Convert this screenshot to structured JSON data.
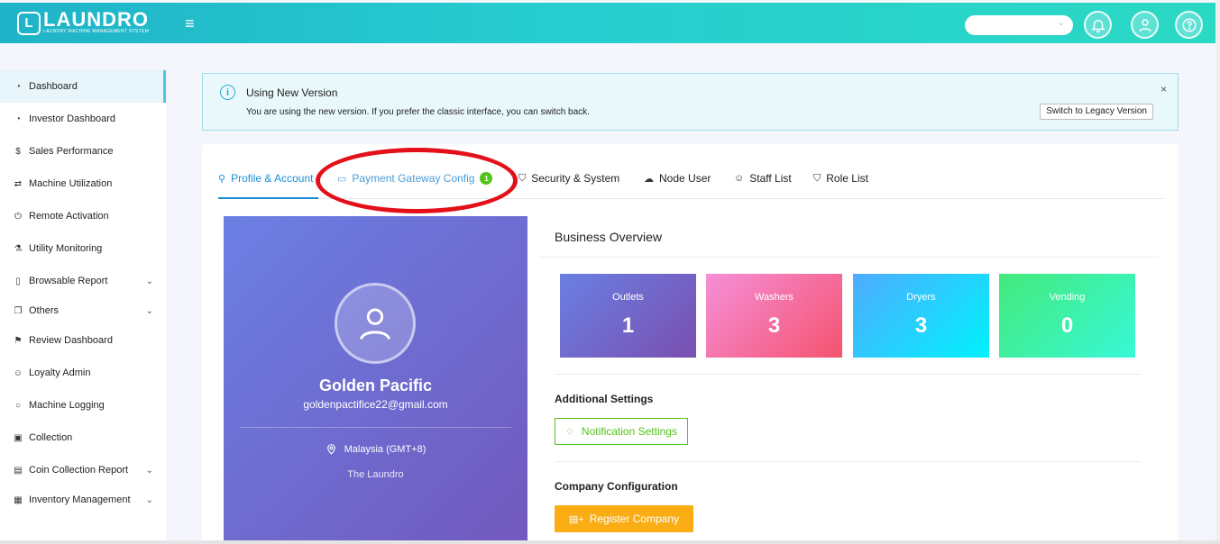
{
  "header": {
    "logo_letter": "L",
    "logo_title": "LAUNDRO",
    "logo_subtitle": "LAUNDRY MACHINE MANAGEMENT SYSTEM",
    "menu_icon": "hamburger-icon",
    "select_value": "",
    "icons": [
      "bell-icon",
      "user-icon",
      "help-icon"
    ]
  },
  "sidebar": {
    "items": [
      {
        "label": "Dashboard",
        "icon": "dashboard-icon",
        "active": true,
        "expandable": false
      },
      {
        "label": "Investor Dashboard",
        "icon": "dashboard-icon",
        "expandable": false
      },
      {
        "label": "Sales Performance",
        "icon": "dollar-icon",
        "expandable": false
      },
      {
        "label": "Machine Utilization",
        "icon": "swap-icon",
        "expandable": false
      },
      {
        "label": "Remote Activation",
        "icon": "power-icon",
        "expandable": false
      },
      {
        "label": "Utility Monitoring",
        "icon": "flask-icon",
        "expandable": false
      },
      {
        "label": "Browsable Report",
        "icon": "report-icon",
        "expandable": true
      },
      {
        "label": "Others",
        "icon": "copy-icon",
        "expandable": true
      },
      {
        "label": "Review Dashboard",
        "icon": "flag-icon",
        "expandable": false
      },
      {
        "label": "Loyalty Admin",
        "icon": "users-icon",
        "expandable": false
      },
      {
        "label": "Machine Logging",
        "icon": "circle-icon",
        "expandable": false
      },
      {
        "label": "Collection",
        "icon": "collection-icon",
        "expandable": false
      },
      {
        "label": "Coin Collection Report",
        "icon": "coin-report-icon",
        "expandable": true
      },
      {
        "label": "Inventory Management",
        "icon": "inventory-icon",
        "expandable": true
      }
    ]
  },
  "notice": {
    "title": "Using New Version",
    "text": "You are using the new version. If you prefer the classic interface, you can switch back.",
    "button": "Switch to Legacy Version",
    "close": "×"
  },
  "tabs": [
    {
      "label": "Profile & Account",
      "icon": "user-icon",
      "active": true
    },
    {
      "label": "Payment Gateway Config",
      "icon": "credit-card-icon",
      "badge": "1"
    },
    {
      "label": "Security & System",
      "icon": "shield-icon"
    },
    {
      "label": "Node User",
      "icon": "cloud-icon"
    },
    {
      "label": "Staff List",
      "icon": "team-icon"
    },
    {
      "label": "Role List",
      "icon": "shield-check-icon"
    }
  ],
  "profile": {
    "name": "Golden Pacific",
    "email": "goldenpactifice22@gmail.com",
    "location": "Malaysia (GMT+8)",
    "company": "The Laundro"
  },
  "overview": {
    "title": "Business Overview",
    "stats": [
      {
        "label": "Outlets",
        "value": "1",
        "color_from": "#6a7fe3",
        "color_to": "#7a4fb0"
      },
      {
        "label": "Washers",
        "value": "3",
        "color_from": "#f58fd8",
        "color_to": "#f5536f"
      },
      {
        "label": "Dryers",
        "value": "3",
        "color_from": "#4facfe",
        "color_to": "#00f2fe"
      },
      {
        "label": "Vending",
        "value": "0",
        "color_from": "#43e97b",
        "color_to": "#38f9d7"
      }
    ]
  },
  "additional_settings": {
    "title": "Additional Settings",
    "button": "Notification Settings"
  },
  "company_config": {
    "title": "Company Configuration",
    "button": "Register Company"
  },
  "colors": {
    "header_from": "#1fb3c7",
    "header_to": "#2ad9c4",
    "tab_active": "#1a8fd6",
    "success": "#52c41a",
    "warning": "#faad14",
    "annotation": "#e3101a"
  }
}
